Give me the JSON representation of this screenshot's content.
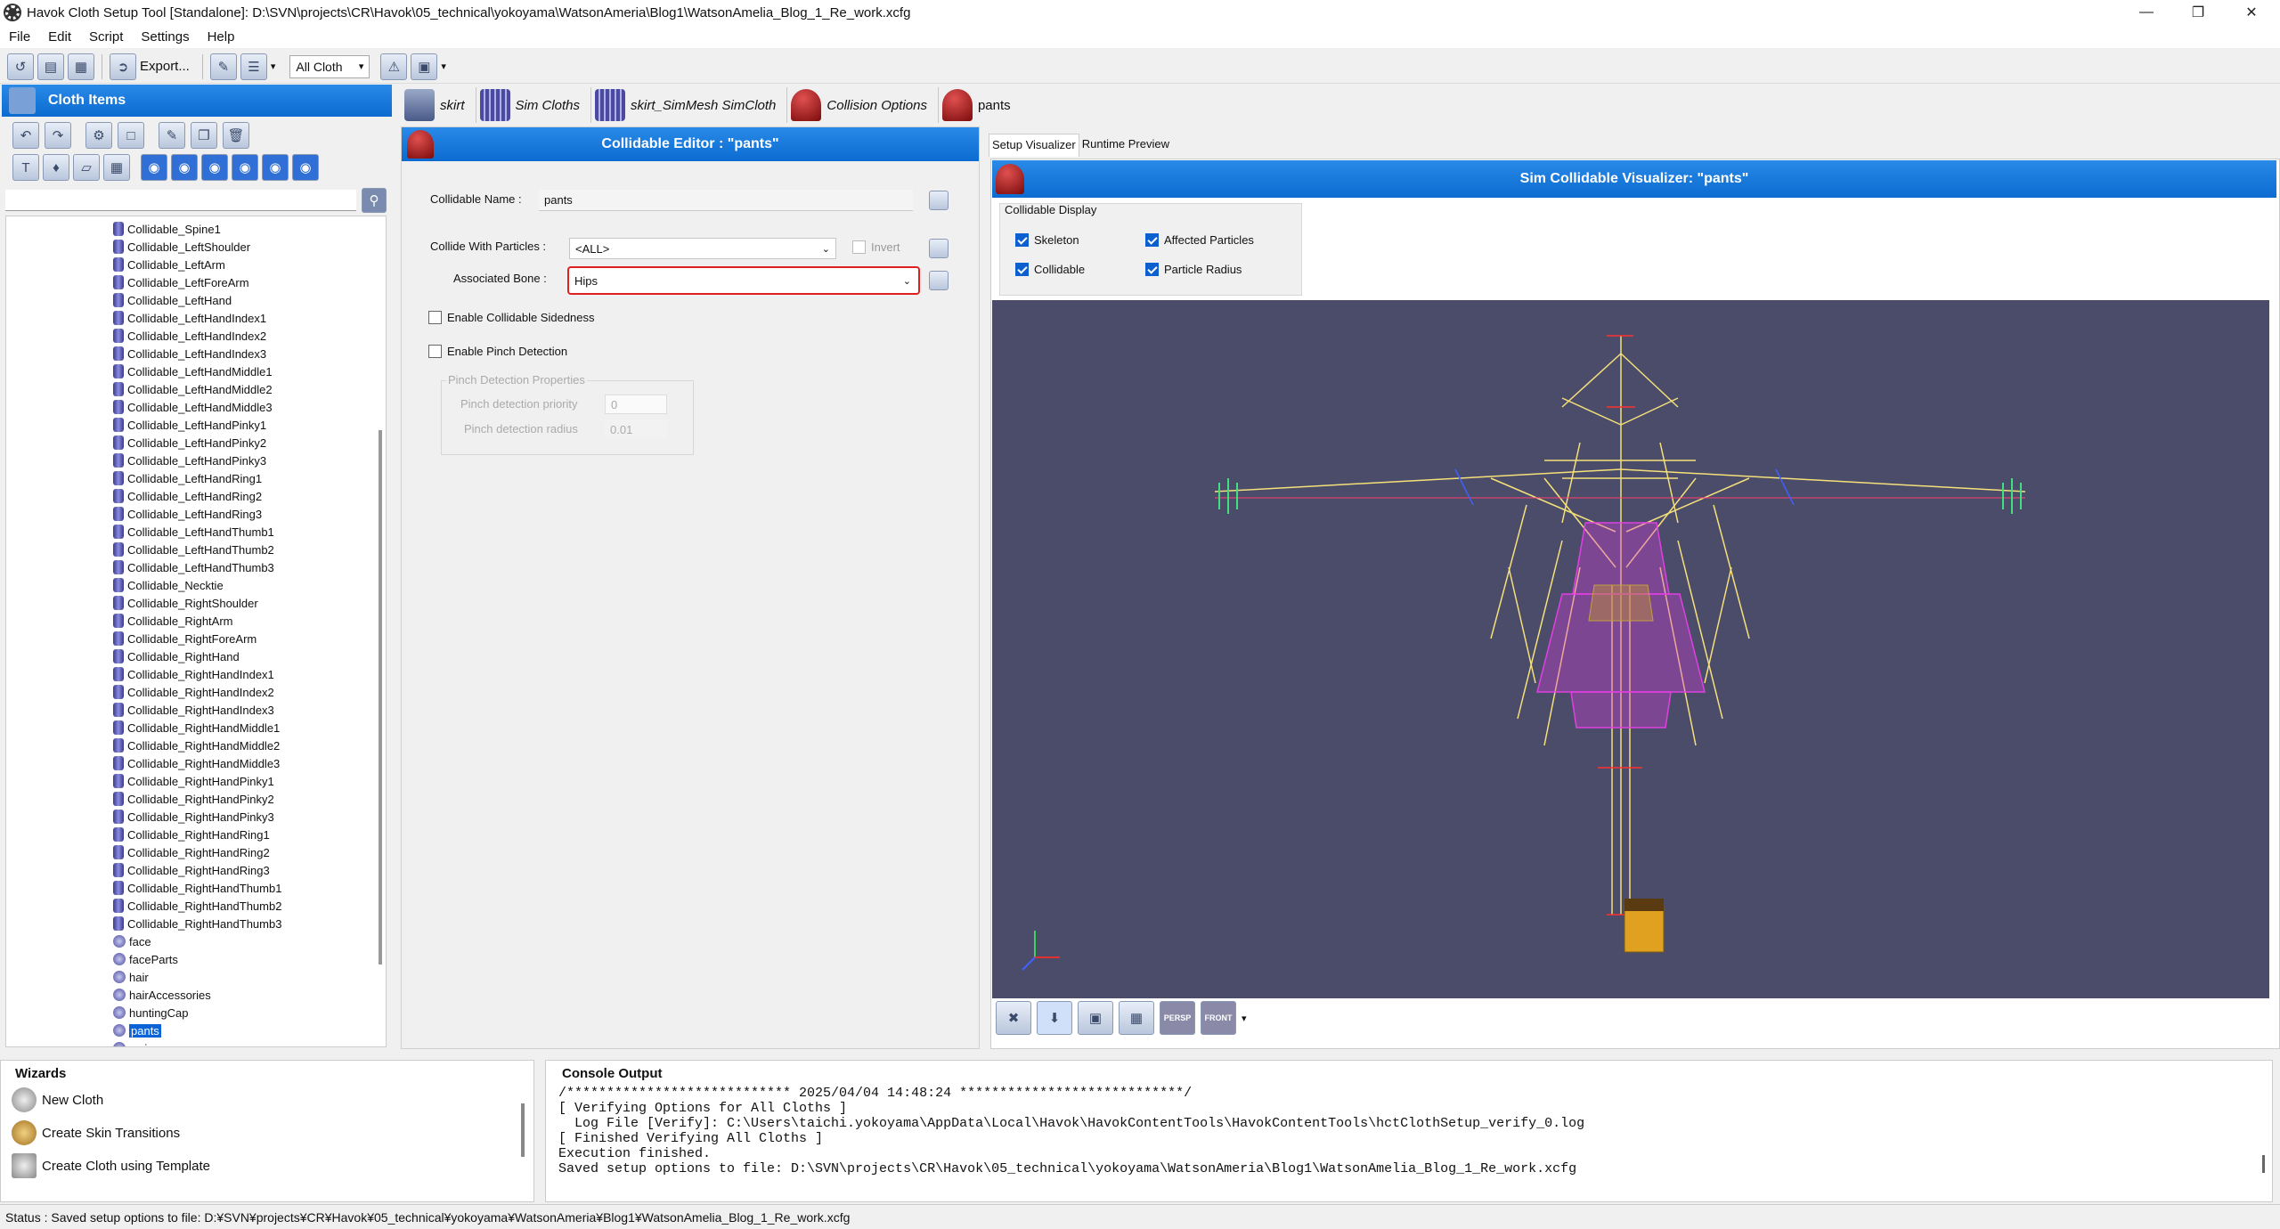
{
  "window": {
    "title": "Havok Cloth Setup Tool [Standalone]: D:\\SVN\\projects\\CR\\Havok\\05_technical\\yokoyama\\WatsonAmeria\\Blog1\\WatsonAmelia_Blog_1_Re_work.xcfg"
  },
  "menu": [
    "File",
    "Edit",
    "Script",
    "Settings",
    "Help"
  ],
  "toolbar": {
    "export_label": "Export...",
    "cloth_filter": "All Cloth"
  },
  "left_panel": {
    "title": "Cloth Items",
    "tree_items": [
      "Collidable_Spine1",
      "Collidable_LeftShoulder",
      "Collidable_LeftArm",
      "Collidable_LeftForeArm",
      "Collidable_LeftHand",
      "Collidable_LeftHandIndex1",
      "Collidable_LeftHandIndex2",
      "Collidable_LeftHandIndex3",
      "Collidable_LeftHandMiddle1",
      "Collidable_LeftHandMiddle2",
      "Collidable_LeftHandMiddle3",
      "Collidable_LeftHandPinky1",
      "Collidable_LeftHandPinky2",
      "Collidable_LeftHandPinky3",
      "Collidable_LeftHandRing1",
      "Collidable_LeftHandRing2",
      "Collidable_LeftHandRing3",
      "Collidable_LeftHandThumb1",
      "Collidable_LeftHandThumb2",
      "Collidable_LeftHandThumb3",
      "Collidable_Necktie",
      "Collidable_RightShoulder",
      "Collidable_RightArm",
      "Collidable_RightForeArm",
      "Collidable_RightHand",
      "Collidable_RightHandIndex1",
      "Collidable_RightHandIndex2",
      "Collidable_RightHandIndex3",
      "Collidable_RightHandMiddle1",
      "Collidable_RightHandMiddle2",
      "Collidable_RightHandMiddle3",
      "Collidable_RightHandPinky1",
      "Collidable_RightHandPinky2",
      "Collidable_RightHandPinky3",
      "Collidable_RightHandRing1",
      "Collidable_RightHandRing2",
      "Collidable_RightHandRing3",
      "Collidable_RightHandThumb1",
      "Collidable_RightHandThumb2",
      "Collidable_RightHandThumb3",
      "face",
      "faceParts",
      "hair",
      "hairAccessories",
      "huntingCap",
      "pants",
      "syringe"
    ],
    "selected_item": "pants"
  },
  "tabs": [
    {
      "label": "skirt"
    },
    {
      "label": "Sim Cloths"
    },
    {
      "label": "skirt_SimMesh SimCloth"
    },
    {
      "label": "Collision Options"
    },
    {
      "label": "pants"
    }
  ],
  "editor": {
    "title": "Collidable Editor : \"pants\"",
    "collidable_name_label": "Collidable Name :",
    "collidable_name_value": "pants",
    "collide_with_label": "Collide With Particles :",
    "collide_with_value": "<ALL>",
    "invert_label": "Invert",
    "associated_bone_label": "Associated Bone :",
    "associated_bone_value": "Hips",
    "sidedness_label": "Enable Collidable Sidedness",
    "pinch_label": "Enable Pinch Detection",
    "pinch_group_label": "Pinch Detection Properties",
    "pinch_priority_label": "Pinch detection priority",
    "pinch_priority_value": "0",
    "pinch_radius_label": "Pinch detection radius",
    "pinch_radius_value": "0.01"
  },
  "visualizer": {
    "tab_setup": "Setup Visualizer",
    "tab_runtime": "Runtime Preview",
    "title": "Sim Collidable Visualizer: \"pants\"",
    "display_group": "Collidable Display",
    "opt_skeleton": "Skeleton",
    "opt_affected": "Affected Particles",
    "opt_collidable": "Collidable",
    "opt_radius": "Particle Radius",
    "btn_persp": "PERSP",
    "btn_front": "FRONT"
  },
  "wizards": {
    "title": "Wizards",
    "items": [
      "New Cloth",
      "Create Skin Transitions",
      "Create Cloth using Template"
    ]
  },
  "console": {
    "title": "Console Output",
    "lines": [
      "/**************************** 2025/04/04 14:48:24 ****************************/",
      "[ Verifying Options for All Cloths ]",
      "  Log File [Verify]: C:\\Users\\taichi.yokoyama\\AppData\\Local\\Havok\\HavokContentTools\\HavokContentTools\\hctClothSetup_verify_0.log",
      "[ Finished Verifying All Cloths ]",
      "Execution finished.",
      "Saved setup options to file: D:\\SVN\\projects\\CR\\Havok\\05_technical\\yokoyama\\WatsonAmeria\\Blog1\\WatsonAmelia_Blog_1_Re_work.xcfg"
    ]
  },
  "status": {
    "text": "Status : Saved setup options to file: D:¥SVN¥projects¥CR¥Havok¥05_technical¥yokoyama¥WatsonAmeria¥Blog1¥WatsonAmelia_Blog_1_Re_work.xcfg"
  },
  "colors": {
    "accent": "#0b6bd0",
    "viewport_bg": "#4a4c6a",
    "highlight_border": "#e02020"
  }
}
